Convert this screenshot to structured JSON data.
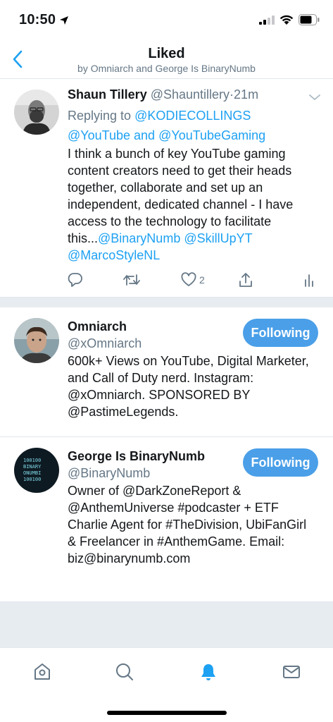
{
  "status_bar": {
    "time": "10:50"
  },
  "header": {
    "title": "Liked",
    "subtitle": "by Omniarch and George Is BinaryNumb"
  },
  "tweet": {
    "name": "Shaun Tillery",
    "handle": "@Shauntillery",
    "dot": "·",
    "time": "21m",
    "replying_prefix": "Replying to ",
    "reply_user1": "@KODIECOLLINGS",
    "reply_user2": "@YouTube",
    "reply_and": " and ",
    "reply_user3": "@YouTubeGaming",
    "text": "I think a bunch of key YouTube gaming content creators need to get their heads together, collaborate and set up an independent, dedicated channel - I have access to the technology to facilitate this...",
    "mention1": "@BinaryNumb",
    "mention2": "@SkillUpYT",
    "mention3": "@MarcoStyleNL",
    "like_count": "2"
  },
  "users": [
    {
      "name": "Omniarch",
      "handle": "@xOmniarch",
      "bio": "600k+ Views on YouTube, Digital Marketer, and Call of Duty nerd. Instagram: @xOmniarch. SPONSORED BY @PastimeLegends.",
      "button": "Following"
    },
    {
      "name": "George Is BinaryNumb",
      "handle": "@BinaryNumb",
      "bio": "Owner of @DarkZoneReport & @AnthemUniverse #podcaster + ETF Charlie Agent for #TheDivision, UbiFanGirl & Freelancer in #AnthemGame. Email: biz@binarynumb.com",
      "button": "Following",
      "avatar_text": [
        "100100",
        "BINARY",
        "ONUMBI",
        "100100"
      ]
    }
  ],
  "colors": {
    "accent": "#1da1f2",
    "button": "#4a9fe8",
    "separator": "#e6ecf0",
    "muted": "#657786"
  },
  "tabs": [
    "home-icon",
    "search-icon",
    "notifications-icon",
    "messages-icon"
  ]
}
